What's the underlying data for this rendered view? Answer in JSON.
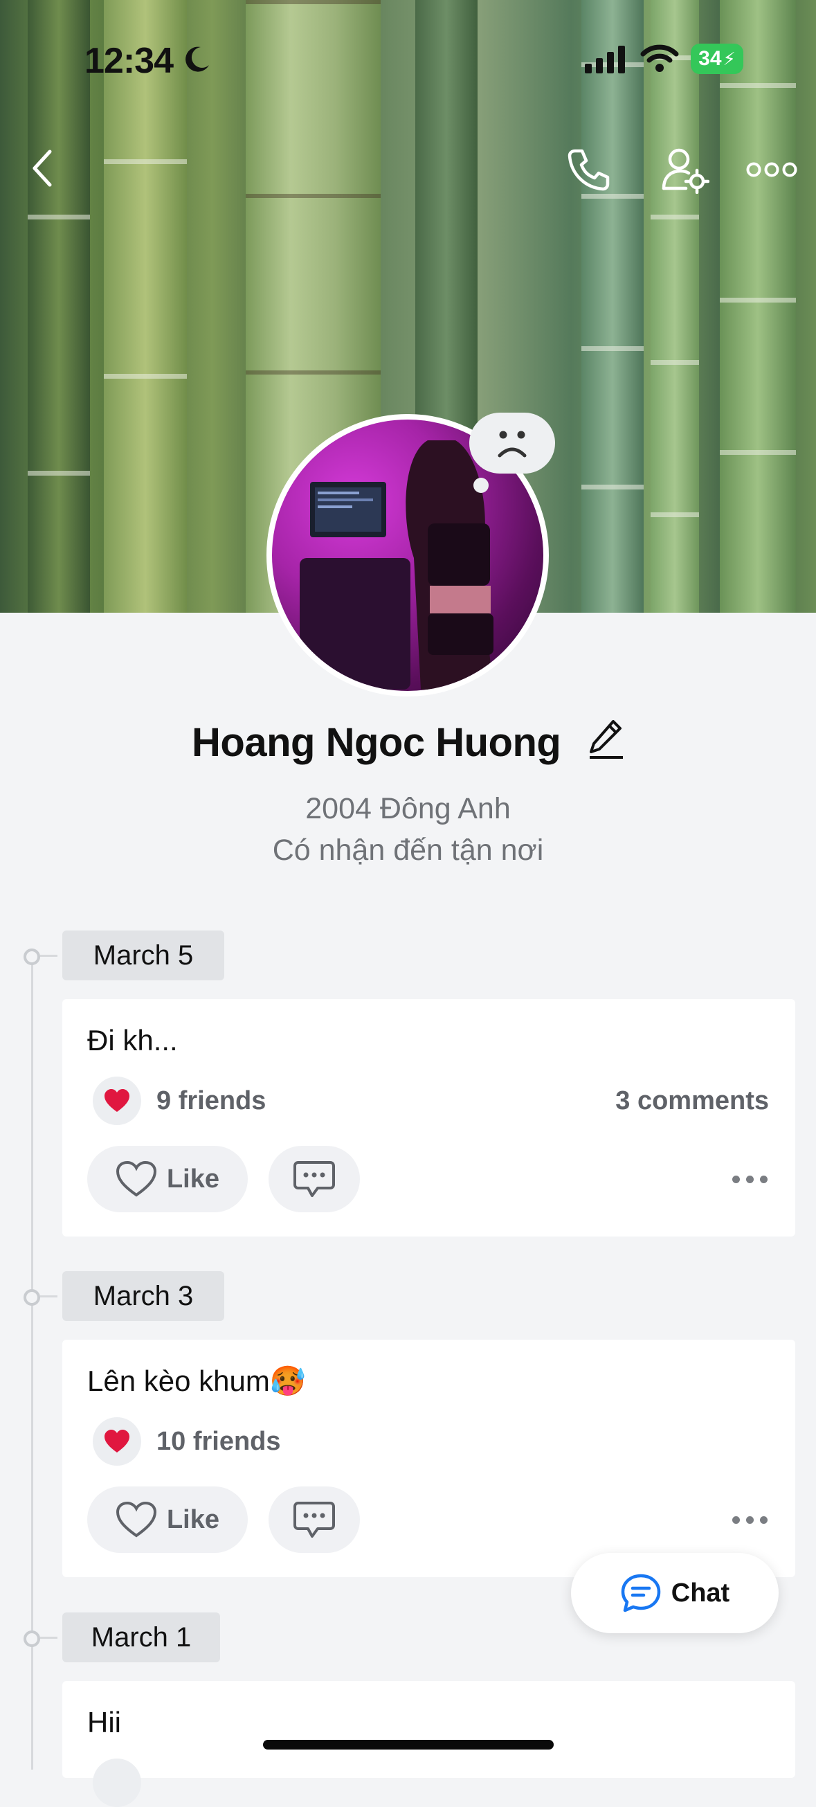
{
  "status_bar": {
    "time": "12:34",
    "battery": "34"
  },
  "profile": {
    "name": "Hoang Ngoc Huong",
    "bio_lines": [
      "2004 Đông Anh",
      "Có nhận đến tận nơi"
    ]
  },
  "posts": [
    {
      "date": "March 5",
      "text": "Đi kh...",
      "reactions": "9 friends",
      "comments": "3 comments",
      "like_label": "Like"
    },
    {
      "date": "March 3",
      "text": "Lên kèo khum🥵",
      "reactions": "10 friends",
      "comments": "",
      "like_label": "Like"
    },
    {
      "date": "March 1",
      "text": "Hii"
    }
  ],
  "chat_button": {
    "label": "Chat"
  },
  "colors": {
    "accent": "#1877f2",
    "battery": "#34c759",
    "heart": "#e0173f"
  },
  "icons": [
    "back-icon",
    "phone-icon",
    "user-settings-icon",
    "more-icon",
    "heart-icon",
    "comment-icon",
    "chat-icon",
    "sad-face-icon",
    "edit-icon"
  ]
}
